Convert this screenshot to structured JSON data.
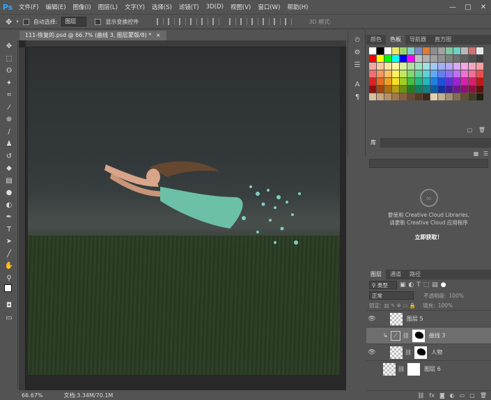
{
  "app": {
    "logo": "Ps"
  },
  "menu": [
    "文件(F)",
    "编辑(E)",
    "图像(I)",
    "图层(L)",
    "文字(Y)",
    "选择(S)",
    "滤镜(T)",
    "3D(D)",
    "视图(V)",
    "窗口(W)",
    "帮助(H)"
  ],
  "window_controls": {
    "minimize": "—",
    "maximize": "□",
    "close": "✕"
  },
  "options": {
    "auto_select_label": "自动选择:",
    "auto_select_value": "图层",
    "show_transform_label": "显示变换控件",
    "mode_3d_label": "3D 模式:"
  },
  "document": {
    "tab_title": "111-恢复的.psd @ 66.7% (曲线 3, 图层蒙版/8) *",
    "close": "×"
  },
  "status": {
    "zoom": "66.67%",
    "doc_size": "文档:3.34M/70.1M"
  },
  "swatches_panel": {
    "tabs": [
      "颜色",
      "色板",
      "导航器",
      "直方图"
    ],
    "active_tab": 1,
    "colors": [
      "#ffffff",
      "#000000",
      "#ffffff",
      "#e8e86a",
      "#9bd36f",
      "#7fd0d0",
      "#7a88c9",
      "#e07a35",
      "#8c8c8c",
      "#a0a0a0",
      "#7fc8a0",
      "#6fcfc4",
      "#b8b8b8",
      "#d07070",
      "#e8e8e8",
      "#ff0000",
      "#ffff00",
      "#00ff00",
      "#00ffff",
      "#0000ff",
      "#ff00ff",
      "#c0c0c0",
      "#b0b0b0",
      "#a0a0a0",
      "#909090",
      "#808080",
      "#707070",
      "#606060",
      "#505050",
      "#404040",
      "#f4a6a6",
      "#f8c8a0",
      "#fbe4a0",
      "#fff6a0",
      "#d8f0a0",
      "#b0e0a0",
      "#a0e0c0",
      "#a0e0e0",
      "#a0c8f0",
      "#a0b0f0",
      "#b8a8f0",
      "#d8a8f0",
      "#f0a8e0",
      "#f0a8c0",
      "#f4a0a0",
      "#f07070",
      "#f49860",
      "#f8c060",
      "#fff060",
      "#c0e860",
      "#80d870",
      "#60d0a0",
      "#60d0d0",
      "#60a8f0",
      "#6080f0",
      "#9070f0",
      "#c070f0",
      "#f070d0",
      "#f07098",
      "#e85050",
      "#e02020",
      "#e86a20",
      "#f0a020",
      "#f8e020",
      "#a0d020",
      "#40c040",
      "#20b880",
      "#20b8b8",
      "#2080e0",
      "#2050d8",
      "#6030d8",
      "#a020d8",
      "#d820b0",
      "#d82070",
      "#c01818",
      "#901010",
      "#a04810",
      "#b07010",
      "#b8a010",
      "#709010",
      "#208020",
      "#108060",
      "#108080",
      "#105aa0",
      "#1030a0",
      "#402090",
      "#701890",
      "#901070",
      "#901040",
      "#601010",
      "#d8c0a0",
      "#c8a880",
      "#b89068",
      "#a07850",
      "#886040",
      "#704830",
      "#583820",
      "#402818",
      "#e0d0b0",
      "#c0b090",
      "#a09070",
      "#807050",
      "#605030",
      "#404020",
      "#202010"
    ]
  },
  "libraries_panel": {
    "tab": "库",
    "message_line1": "要使用 Creative Cloud Libraries,",
    "message_line2": "请更新 Creative Cloud 应用程序",
    "link": "立即获取！"
  },
  "layers_panel": {
    "tabs": [
      "图层",
      "通道",
      "路径"
    ],
    "active_tab": 0,
    "filter_label": "类型",
    "blend_mode": "正常",
    "opacity_label": "不透明度:",
    "opacity_value": "100%",
    "lock_label": "锁定:",
    "fill_label": "填充:",
    "fill_value": "100%",
    "layers": [
      {
        "name": "图层 5",
        "visible": true,
        "selected": false,
        "type": "pixel"
      },
      {
        "name": "曲线 3",
        "visible": false,
        "selected": true,
        "type": "adjustment"
      },
      {
        "name": "人物",
        "visible": true,
        "selected": false,
        "type": "masked"
      },
      {
        "name": "图层 6",
        "visible": false,
        "selected": false,
        "type": "masked-white"
      }
    ],
    "bottom_icons": [
      "link-icon",
      "fx-icon",
      "mask-icon",
      "adjustment-icon",
      "group-icon",
      "new-layer-icon",
      "trash-icon"
    ]
  },
  "tools": [
    "move-icon",
    "marquee-icon",
    "lasso-icon",
    "magic-wand-icon",
    "crop-icon",
    "eyedropper-icon",
    "healing-icon",
    "brush-icon",
    "stamp-icon",
    "history-brush-icon",
    "eraser-icon",
    "gradient-icon",
    "blur-icon",
    "dodge-icon",
    "pen-icon",
    "type-icon",
    "path-select-icon",
    "line-icon",
    "hand-icon",
    "zoom-icon",
    "more-icon"
  ]
}
